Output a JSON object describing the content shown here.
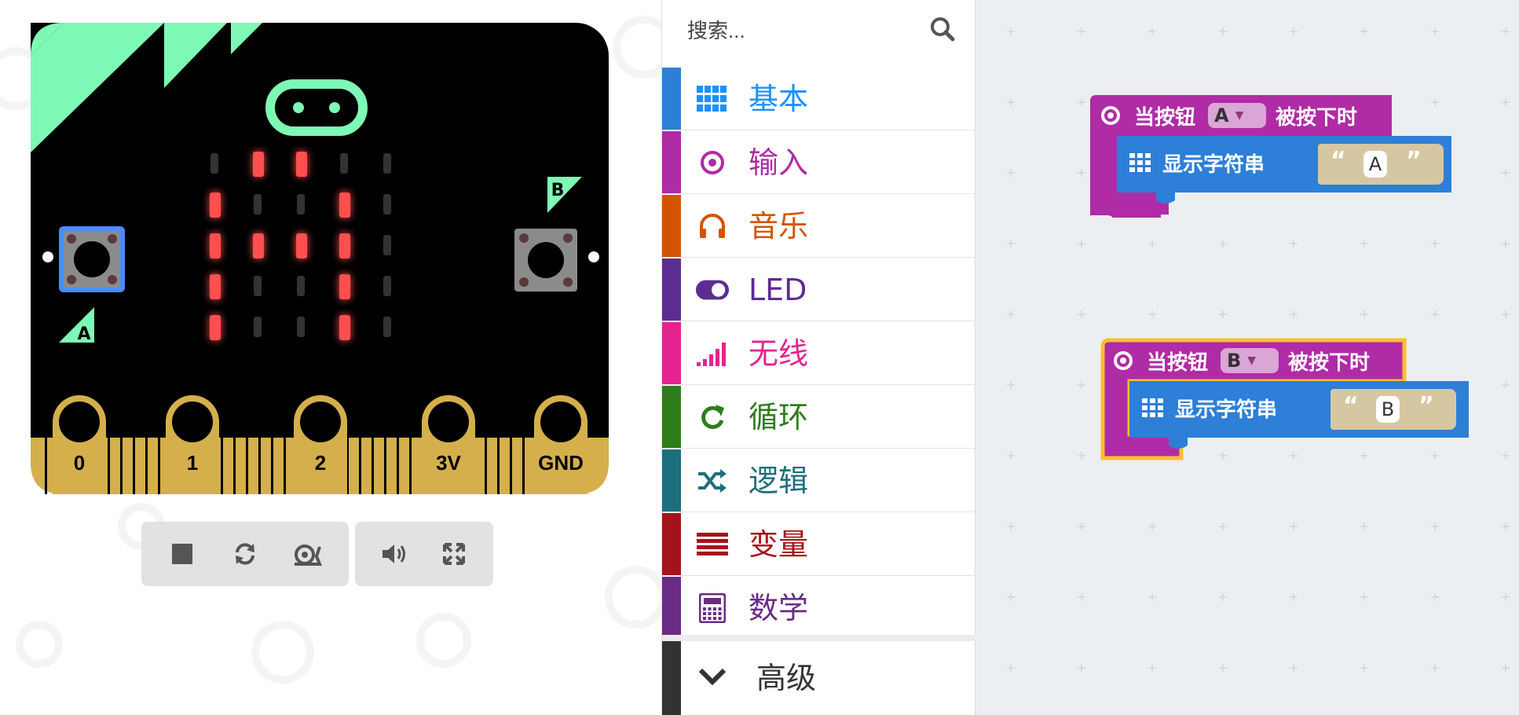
{
  "simulator": {
    "pins": [
      "0",
      "1",
      "2",
      "3V",
      "GND"
    ],
    "button_a_label": "A",
    "button_b_label": "B",
    "led_matrix": [
      [
        0,
        1,
        1,
        0,
        0
      ],
      [
        1,
        0,
        0,
        1,
        0
      ],
      [
        1,
        1,
        1,
        1,
        0
      ],
      [
        1,
        0,
        0,
        1,
        0
      ],
      [
        1,
        0,
        0,
        1,
        0
      ]
    ],
    "colors": {
      "board": "#000000",
      "accent": "#7ef9b5",
      "edge_gold": "#d4af4c",
      "led_on": "#ff4f4f",
      "button_a_highlight": "#4a8cff"
    },
    "toolbar": {
      "stop_icon": "stop-icon",
      "restart_icon": "restart-icon",
      "slowmo_icon": "snail-icon",
      "mute_icon": "volume-icon",
      "fullscreen_icon": "fullscreen-icon"
    }
  },
  "toolbox": {
    "search_placeholder": "搜索...",
    "categories": [
      {
        "label": "基本",
        "color": "#1e90ff",
        "stripe": "#2d7fd7",
        "icon": "grid-icon"
      },
      {
        "label": "输入",
        "color": "#b02ba6",
        "stripe": "#b02ba6",
        "icon": "radio-target-icon"
      },
      {
        "label": "音乐",
        "color": "#d35400",
        "stripe": "#d35400",
        "icon": "headphones-icon"
      },
      {
        "label": "LED",
        "color": "#5c2d91",
        "stripe": "#5c2d91",
        "icon": "toggle-icon"
      },
      {
        "label": "无线",
        "color": "#e3238f",
        "stripe": "#e3238f",
        "icon": "signal-icon"
      },
      {
        "label": "循环",
        "color": "#2e7d1a",
        "stripe": "#2e7d1a",
        "icon": "refresh-icon"
      },
      {
        "label": "逻辑",
        "color": "#1e6e7d",
        "stripe": "#1e6e7d",
        "icon": "shuffle-icon"
      },
      {
        "label": "变量",
        "color": "#a4141b",
        "stripe": "#a4141b",
        "icon": "list-icon"
      },
      {
        "label": "数学",
        "color": "#6a2b85",
        "stripe": "#6a2b85",
        "icon": "calculator-icon"
      }
    ],
    "advanced_label": "高级",
    "advanced_color": "#333333"
  },
  "workspace": {
    "blocks": [
      {
        "event_label": "当按钮",
        "button_value": "A",
        "event_suffix": "被按下时",
        "inner_label": "显示字符串",
        "string_value": "A",
        "selected": false
      },
      {
        "event_label": "当按钮",
        "button_value": "B",
        "event_suffix": "被按下时",
        "inner_label": "显示字符串",
        "string_value": "B",
        "selected": true
      }
    ],
    "colors": {
      "event_block": "#b02ba6",
      "basic_block": "#2d7fd7",
      "string_block": "#d6c7a3",
      "selection": "#fbc02d"
    }
  }
}
